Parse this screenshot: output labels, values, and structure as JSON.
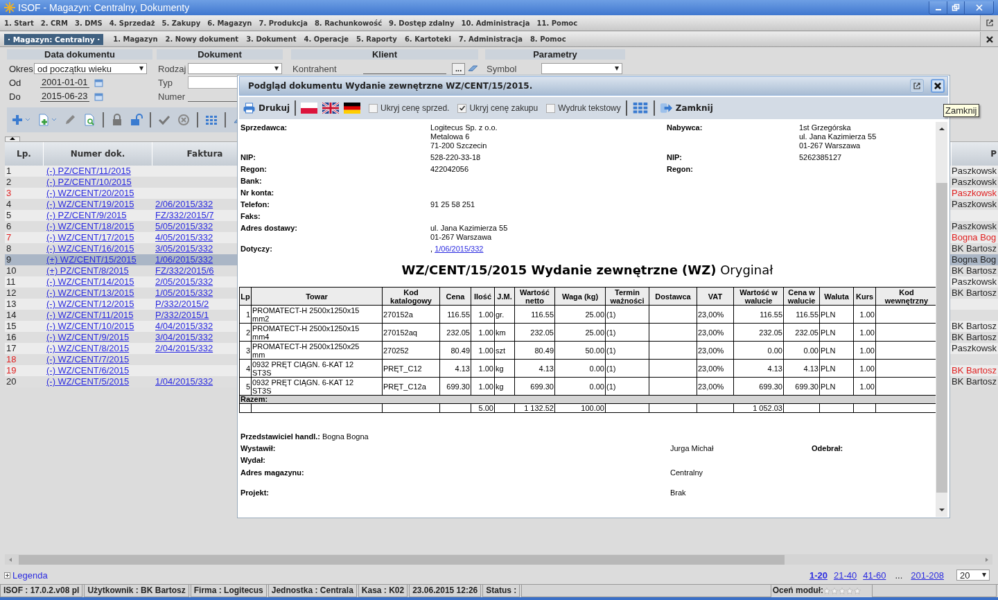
{
  "window": {
    "title": "ISOF - Magazyn: Centralny, Dokumenty"
  },
  "main_menu": [
    "1. Start",
    "2. CRM",
    "3. DMS",
    "4. Sprzedaż",
    "5. Zakupy",
    "6. Magazyn",
    "7. Produkcja",
    "8. Rachunkowość",
    "9. Dostęp zdalny",
    "10. Administracja",
    "11. Pomoc"
  ],
  "module_button": "· Magazyn: Centralny ·",
  "sub_menu": [
    "1. Magazyn",
    "2. Nowy dokument",
    "3. Dokument",
    "4. Operacje",
    "5. Raporty",
    "6. Kartoteki",
    "7. Administracja",
    "8. Pomoc"
  ],
  "filters": {
    "date": {
      "title": "Data dokumentu",
      "period_label": "Okres",
      "period": "od początku wieku",
      "from_label": "Od",
      "from": "2001-01-01",
      "to_label": "Do",
      "to": "2015-06-23"
    },
    "document": {
      "title": "Dokument",
      "kind_label": "Rodzaj",
      "type_label": "Typ",
      "number_label": "Numer"
    },
    "client": {
      "title": "Klient",
      "contractor_label": "Kontrahent",
      "browse": "..."
    },
    "parameters": {
      "title": "Parametry",
      "symbol_label": "Symbol"
    }
  },
  "documents": {
    "columns": [
      "Lp.",
      "Numer dok.",
      "Faktura",
      "P"
    ],
    "rows": [
      {
        "lp": "1",
        "number": "(-) PZ/CENT/11/2015",
        "column_4": "Paszkowsk",
        "flagged": false,
        "selected": false
      },
      {
        "lp": "2",
        "number": "(-) PZ/CENT/10/2015",
        "column_4": "Paszkowsk",
        "flagged": false,
        "selected": false
      },
      {
        "lp": "3",
        "number": "(-) WZ/CENT/20/2015",
        "column_4": "Paszkowsk",
        "flagged": true,
        "selected": false
      },
      {
        "lp": "4",
        "number": "(-) WZ/CENT/19/2015",
        "invoice": "2/06/2015/332",
        "column_4": "Paszkowsk",
        "flagged": false,
        "selected": false
      },
      {
        "lp": "5",
        "number": "(-) PZ/CENT/9/2015",
        "invoice": "FZ/332/2015/7",
        "flagged": false,
        "selected": false
      },
      {
        "lp": "6",
        "number": "(-) WZ/CENT/18/2015",
        "invoice": "5/05/2015/332",
        "column_4": "Paszkowsk",
        "flagged": false,
        "selected": false
      },
      {
        "lp": "7",
        "number": "(-) WZ/CENT/17/2015",
        "invoice": "4/05/2015/332",
        "column_4": "Bogna Bog",
        "flagged": true,
        "selected": false
      },
      {
        "lp": "8",
        "number": "(-) WZ/CENT/16/2015",
        "invoice": "3/05/2015/332",
        "column_4": "BK Bartosz",
        "flagged": false,
        "selected": false
      },
      {
        "lp": "9",
        "number": "(+) WZ/CENT/15/2015",
        "invoice": "1/06/2015/332",
        "column_4": "Bogna Bog",
        "flagged": false,
        "selected": true
      },
      {
        "lp": "10",
        "number": "(+) PZ/CENT/8/2015",
        "invoice": "FZ/332/2015/6",
        "column_4": "BK Bartosz",
        "flagged": false,
        "selected": false
      },
      {
        "lp": "11",
        "number": "(-) WZ/CENT/14/2015",
        "invoice": "2/05/2015/332",
        "column_4": "Paszkowsk",
        "flagged": false,
        "selected": false
      },
      {
        "lp": "12",
        "number": "(-) WZ/CENT/13/2015",
        "invoice": "1/05/2015/332",
        "column_4": "BK Bartosz",
        "flagged": false,
        "selected": false
      },
      {
        "lp": "13",
        "number": "(-) WZ/CENT/12/2015",
        "invoice": "P/332/2015/2",
        "flagged": false,
        "selected": false
      },
      {
        "lp": "14",
        "number": "(-) WZ/CENT/11/2015",
        "invoice": "P/332/2015/1",
        "flagged": false,
        "selected": false
      },
      {
        "lp": "15",
        "number": "(-) WZ/CENT/10/2015",
        "invoice": "4/04/2015/332",
        "column_4": "BK Bartosz",
        "flagged": false,
        "selected": false
      },
      {
        "lp": "16",
        "number": "(-) WZ/CENT/9/2015",
        "invoice": "3/04/2015/332",
        "column_4": "BK Bartosz",
        "flagged": false,
        "selected": false
      },
      {
        "lp": "17",
        "number": "(-) WZ/CENT/8/2015",
        "invoice": "2/04/2015/332",
        "column_4": "Paszkowsk",
        "flagged": false,
        "selected": false
      },
      {
        "lp": "18",
        "number": "(-) WZ/CENT/7/2015",
        "flagged": true,
        "selected": false
      },
      {
        "lp": "19",
        "number": "(-) WZ/CENT/6/2015",
        "column_4": "BK Bartosz",
        "flagged": true,
        "selected": false
      },
      {
        "lp": "20",
        "number": "(-) WZ/CENT/5/2015",
        "invoice": "1/04/2015/332",
        "column_4": "BK Bartosz",
        "flagged": false,
        "selected": false
      }
    ]
  },
  "legend": "Legenda",
  "pagination": {
    "pages": [
      {
        "kind": "link",
        "label": "1-20",
        "selected": true
      },
      {
        "kind": "link",
        "label": "21-40",
        "selected": false
      },
      {
        "kind": "link",
        "label": "41-60",
        "selected": false
      },
      {
        "kind": "gap",
        "label": "..."
      },
      {
        "kind": "link",
        "label": "201-208",
        "selected": false
      }
    ],
    "page_size": "20"
  },
  "status_bar": {
    "fields": [
      "ISOF : 17.0.2.v08 pl",
      "Użytkownik : BK Bartosz",
      "Firma : Logitecus",
      "Jednostka : Centrala",
      "Kasa : K02",
      "23.06.2015 12:26",
      "Status :"
    ],
    "rating_label": "Oceń moduł:",
    "stars": 0
  },
  "preview": {
    "title": "Podgląd dokumentu Wydanie zewnętrzne WZ/CENT/15/2015.",
    "toolbar": {
      "print": "Drukuj",
      "options": [
        {
          "label": "Ukryj cenę sprzed.",
          "checked": false
        },
        {
          "label": "Ukryj cenę zakupu",
          "checked": true
        },
        {
          "label": "Wydruk tekstowy",
          "checked": false
        }
      ],
      "close": "Zamknij"
    },
    "tooltip": "Zamknij",
    "details": [
      {
        "label": "Sprzedawca:",
        "value": [
          "Logitecus Sp. z o.o.",
          "Metalowa 6",
          "71-200 Szczecin"
        ],
        "right_label": "Nabywca:",
        "right_value": [
          "1st Grzegórska",
          "ul. Jana Kazimierza 55",
          "01-267 Warszawa"
        ]
      },
      {
        "label": "NIP:",
        "value": [
          "528-220-33-18"
        ],
        "right_label": "NIP:",
        "right_value": [
          "5262385127"
        ]
      },
      {
        "label": "Regon:",
        "value": [
          "422042056"
        ],
        "right_label": "Regon:"
      },
      {
        "label": "Bank:"
      },
      {
        "label": "Nr konta:"
      },
      {
        "label": "Telefon:",
        "value": [
          "91 25 58 251"
        ]
      },
      {
        "label": "Faks:"
      },
      {
        "label": "Adres dostawy:",
        "value": [
          "ul. Jana Kazimierza 55",
          "01-267 Warszawa"
        ]
      },
      {
        "label": "Dotyczy:",
        "prefix": ",",
        "link": "1/06/2015/332"
      }
    ],
    "document_title": "**WZ/CENT/15/2015 Wydanie zewnętrzne (WZ)** Oryginał",
    "items": {
      "columns": [
        "Lp",
        "Towar",
        "Kod katalogowy",
        "Cena",
        "Ilość",
        "J.M.",
        "Wartość netto",
        "Waga (kg)",
        "Termin ważności",
        "Dostawca",
        "VAT",
        "Wartość w walucie",
        "Cena w walucie",
        "Waluta",
        "Kurs",
        "Kod wewnętrzny"
      ],
      "rows": [
        {
          "lp": "1",
          "product": "PROMATECT-H 2500x1250x15 mm2",
          "code": "270152a",
          "price": "116.55",
          "qty": "1.00",
          "unit": "gr.",
          "net": "116.55",
          "weight": "25.00",
          "expiry": "(1)",
          "vat": "23,00%",
          "value_cur": "116.55",
          "price_cur": "116.55",
          "currency": "PLN",
          "rate": "1.00"
        },
        {
          "lp": "2",
          "product": "PROMATECT-H 2500x1250x15 mm4",
          "code": "270152aq",
          "price": "232.05",
          "qty": "1.00",
          "unit": "km",
          "net": "232.05",
          "weight": "25.00",
          "expiry": "(1)",
          "vat": "23,00%",
          "value_cur": "232.05",
          "price_cur": "232.05",
          "currency": "PLN",
          "rate": "1.00"
        },
        {
          "lp": "3",
          "product": "PROMATECT-H 2500x1250x25 mm",
          "code": "270252",
          "price": "80.49",
          "qty": "1.00",
          "unit": "szt",
          "net": "80.49",
          "weight": "50.00",
          "expiry": "(1)",
          "vat": "23,00%",
          "value_cur": "0.00",
          "price_cur": "0.00",
          "currency": "PLN",
          "rate": "1.00"
        },
        {
          "lp": "4",
          "product": "0932 PRĘT CIĄGN. 6-KAT 12 ST3S",
          "code": "PRĘT_C12",
          "price": "4.13",
          "qty": "1.00",
          "unit": "kg",
          "net": "4.13",
          "weight": "0.00",
          "expiry": "(1)",
          "vat": "23,00%",
          "value_cur": "4.13",
          "price_cur": "4.13",
          "currency": "PLN",
          "rate": "1.00"
        },
        {
          "lp": "5",
          "product": "0932 PRĘT CIĄGN. 6-KAT 12 ST3S",
          "code": "PRĘT_C12a",
          "price": "699.30",
          "qty": "1.00",
          "unit": "kg",
          "net": "699.30",
          "weight": "0.00",
          "expiry": "(1)",
          "vat": "23,00%",
          "value_cur": "699.30",
          "price_cur": "699.30",
          "currency": "PLN",
          "rate": "1.00"
        }
      ],
      "total_label": "Razem:",
      "totals": {
        "qty": "5.00",
        "net": "1 132.52",
        "weight": "100.00",
        "value_cur": "1 052.03"
      }
    },
    "footer": {
      "representative": "**Przedstawiciel handl.:** Bogna Bogna",
      "rows": [
        {
          "label": "Wystawił:",
          "value": "Jurga Michał",
          "right_label": "Odebrał:"
        },
        {
          "label": "Wydał:"
        },
        {
          "label": "Adres magazynu:",
          "value": "Centralny"
        },
        {
          "label": "Projekt:",
          "value": "Brak"
        }
      ]
    }
  }
}
